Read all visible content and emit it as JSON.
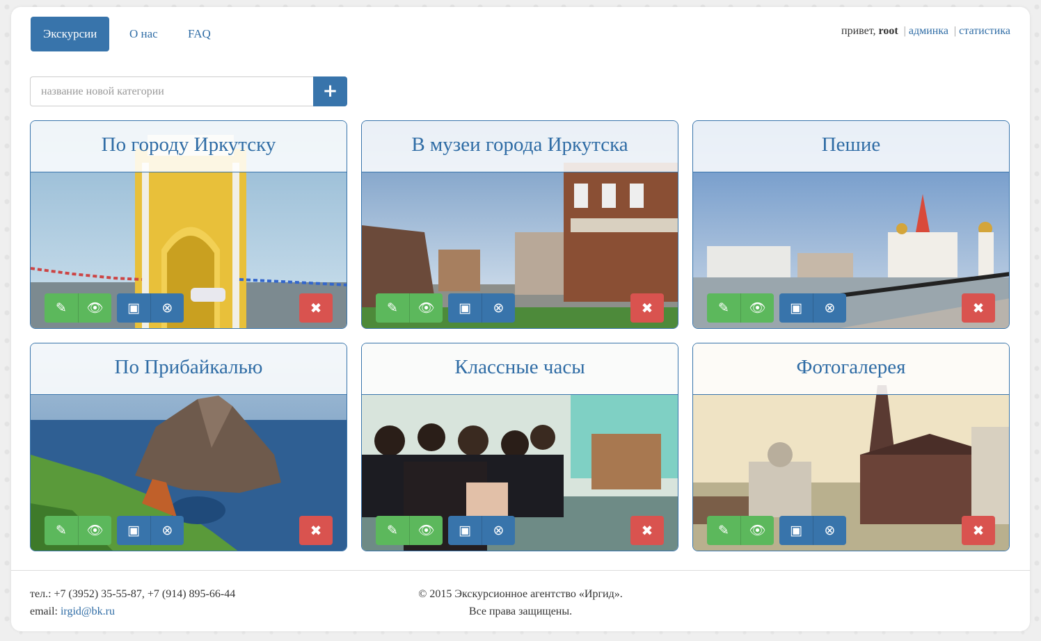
{
  "nav": {
    "items": [
      {
        "label": "Экскурсии",
        "active": true
      },
      {
        "label": "О нас",
        "active": false
      },
      {
        "label": "FAQ",
        "active": false
      }
    ]
  },
  "user": {
    "greeting": "привет,",
    "username": "root",
    "admin_link": "админка",
    "stats_link": "статистика"
  },
  "add_category": {
    "placeholder": "название новой категории",
    "button_icon": "plus-icon",
    "button_glyph": "+"
  },
  "categories": [
    {
      "title": "По городу Иркутску",
      "image": "triumphal-arch-photo"
    },
    {
      "title": "В музеи города Иркутска",
      "image": "wooden-street-photo"
    },
    {
      "title": "Пешие",
      "image": "embankment-church-photo"
    },
    {
      "title": "По Прибайкалью",
      "image": "baikal-rock-photo"
    },
    {
      "title": "Классные часы",
      "image": "students-classroom-photo"
    },
    {
      "title": "Фотогалерея",
      "image": "old-city-cathedral-photo"
    }
  ],
  "card_buttons": {
    "edit": {
      "icon": "edit-icon",
      "glyph": "✎"
    },
    "view": {
      "icon": "eye-icon",
      "glyph": "👁"
    },
    "image": {
      "icon": "image-icon",
      "glyph": "▣"
    },
    "disable": {
      "icon": "circle-x-icon",
      "glyph": "⊗"
    },
    "delete": {
      "icon": "close-icon",
      "glyph": "✖"
    }
  },
  "footer": {
    "phone": "тел.: +7 (3952) 35-55-87, +7 (914) 895-66-44",
    "email_label": "email:",
    "email": "irgid@bk.ru",
    "copyright": "© 2015 Экскурсионное агентство «Иргид».",
    "rights": "Все права защищены."
  },
  "colors": {
    "primary": "#3874ab",
    "success": "#5cb85c",
    "danger": "#d9534f",
    "link": "#2f6ca5"
  }
}
